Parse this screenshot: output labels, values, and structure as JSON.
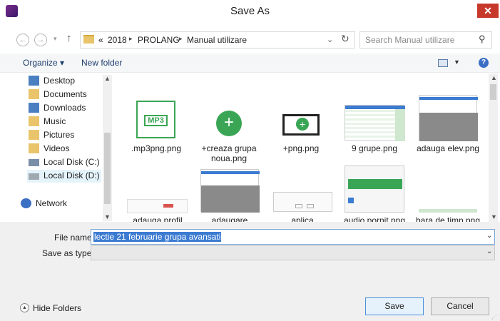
{
  "window": {
    "title": "Save As",
    "close_label": "✕"
  },
  "address": {
    "breadcrumbs": [
      "«",
      "2018",
      "PROLANG",
      "Manual utilizare"
    ],
    "search_placeholder": "Search Manual utilizare"
  },
  "toolbar": {
    "organize_label": "Organize ▾",
    "new_folder_label": "New folder"
  },
  "nav": {
    "items": [
      {
        "label": "Desktop",
        "icon": "desktop-folder-icon",
        "color": "#4a7fc1"
      },
      {
        "label": "Documents",
        "icon": "documents-folder-icon",
        "color": "#e9c46a"
      },
      {
        "label": "Downloads",
        "icon": "downloads-folder-icon",
        "color": "#4a7fc1"
      },
      {
        "label": "Music",
        "icon": "music-folder-icon",
        "color": "#e9c46a"
      },
      {
        "label": "Pictures",
        "icon": "pictures-folder-icon",
        "color": "#e9c46a"
      },
      {
        "label": "Videos",
        "icon": "videos-folder-icon",
        "color": "#e9c46a"
      },
      {
        "label": "Local Disk (C:)",
        "icon": "disk-c-icon",
        "color": "#7a8ea8"
      },
      {
        "label": "Local Disk (D:)",
        "icon": "disk-d-icon",
        "color": "#a0a8b0"
      }
    ],
    "network_label": "Network",
    "selected": "Local Disk (D:)"
  },
  "files": [
    {
      "name": ".mp3png.png",
      "icon_text": "MP3"
    },
    {
      "name": "+creaza grupa noua.png"
    },
    {
      "name": "+png.png"
    },
    {
      "name": "9 grupe.png"
    },
    {
      "name": "adauga elev.png"
    },
    {
      "name": "adauga profil"
    },
    {
      "name": "adaugare"
    },
    {
      "name": "aplica"
    },
    {
      "name": "audio pornit.png"
    },
    {
      "name": "bara de timp.png"
    }
  ],
  "form": {
    "file_name_label": "File name:",
    "file_name_value": "lectie 21 februarie grupa avansati",
    "save_type_label": "Save as type:",
    "save_type_value": ""
  },
  "footer": {
    "hide_folders_label": "Hide Folders",
    "save_label": "Save",
    "cancel_label": "Cancel"
  },
  "colors": {
    "accent": "#3b7bd1",
    "close": "#c7392b",
    "green": "#3aa655"
  }
}
